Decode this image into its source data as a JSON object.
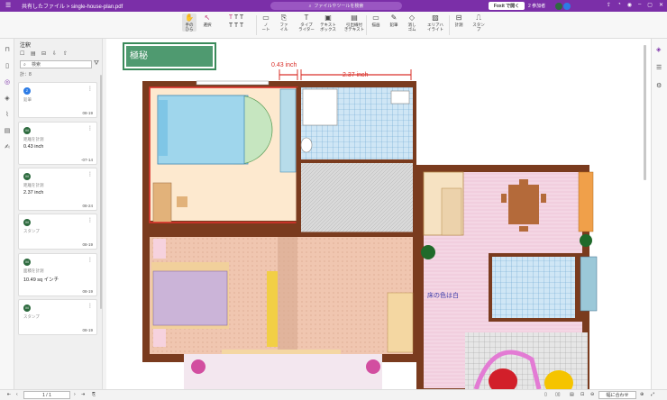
{
  "titlebar": {
    "breadcrumb": "共有したファイル > single-house-plan.pdf",
    "search_placeholder": "ファイルやツールを検索",
    "open_button": "Foxit で開く",
    "joined_label": "2 参加者"
  },
  "toolbar": {
    "tools": [
      {
        "icon": "hand-icon",
        "glyph": "✋",
        "label": "手の\nひら"
      },
      {
        "icon": "select-icon",
        "glyph": "↖",
        "label": "選択"
      },
      {
        "icon": "text-highlight-icon",
        "glyph": "T",
        "label": ""
      },
      {
        "icon": "note-icon",
        "glyph": "🗨",
        "label": "ノ\nート"
      },
      {
        "icon": "file-icon",
        "glyph": "📎",
        "label": "ファ\nイル"
      },
      {
        "icon": "typewriter-icon",
        "glyph": "T",
        "label": "タイプ\nライター"
      },
      {
        "icon": "textbox-icon",
        "glyph": "▣",
        "label": "テキスト\nボックス"
      },
      {
        "icon": "callout-icon",
        "glyph": "▤",
        "label": "引出線付\nきテキスト"
      },
      {
        "icon": "shape-icon",
        "glyph": "▭",
        "label": "描画"
      },
      {
        "icon": "eraser-icon",
        "glyph": "⌫",
        "label": "鉛筆"
      },
      {
        "icon": "eraser2-icon",
        "glyph": "◇",
        "label": "消し\nゴム"
      },
      {
        "icon": "area-highlight-icon",
        "glyph": "▨",
        "label": "エリアハ\nイライト"
      },
      {
        "icon": "measure-icon",
        "glyph": "📏",
        "label": "計測"
      },
      {
        "icon": "stamp-icon",
        "glyph": "⎍",
        "label": "スタン\nプ"
      }
    ]
  },
  "panel": {
    "title": "注釈",
    "search_placeholder": "検索",
    "count": "計：8",
    "cards": [
      {
        "type": "鉛筆",
        "value": "",
        "date": "08-19",
        "color": "#2c7be5",
        "initial": "Z"
      },
      {
        "type": "距離を計測",
        "value": "0.43 inch",
        "date": "-07-14",
        "color": "#2d6a3e",
        "initial": "M"
      },
      {
        "type": "距離を計測",
        "value": "2.37 inch",
        "date": "08-24",
        "color": "#2d6a3e",
        "initial": "M"
      },
      {
        "type": "スタンプ",
        "value": "",
        "date": "08-19",
        "color": "#2d6a3e",
        "initial": "M"
      },
      {
        "type": "面積を計測",
        "value": "10.49 sq インチ",
        "date": "08-19",
        "color": "#2d6a3e",
        "initial": "M"
      },
      {
        "type": "スタンプ",
        "value": "",
        "date": "08-19",
        "color": "#2d6a3e",
        "initial": "M"
      }
    ]
  },
  "plan": {
    "stamp": "極秘",
    "measure1": "0.43 inch",
    "measure2": "2.37 inch",
    "floor_note": "床の色は白"
  },
  "statusbar": {
    "page": "1 / 1",
    "zoom": "幅に合わせ"
  },
  "colors": {
    "brand": "#7b2fa8",
    "wall": "#7a3b1e",
    "measure": "#d9302a",
    "stamp": "#3a8a5a"
  }
}
